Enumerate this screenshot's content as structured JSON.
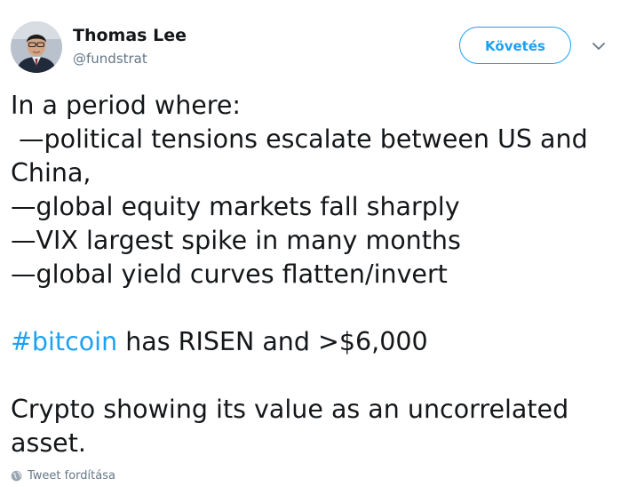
{
  "author": {
    "name": "Thomas Lee",
    "handle": "@fundstrat"
  },
  "follow_button": {
    "label": "Követés"
  },
  "tweet": {
    "lines": [
      "In a period where:",
      " —political tensions escalate between US and",
      "China,",
      "—global equity markets fall sharply",
      "—VIX largest spike in many months",
      "—global yield curves flatten/invert"
    ],
    "hashtag": "#bitcoin",
    "hashtag_line_rest": " has RISEN and >$6,000",
    "closing_lines": [
      "Crypto showing its value as an uncorrelated",
      "asset."
    ]
  },
  "translate": {
    "label": "Tweet fordítása",
    "icon": "globe-icon"
  },
  "colors": {
    "accent": "#1da1f2",
    "text": "#14171a",
    "muted": "#657786"
  }
}
